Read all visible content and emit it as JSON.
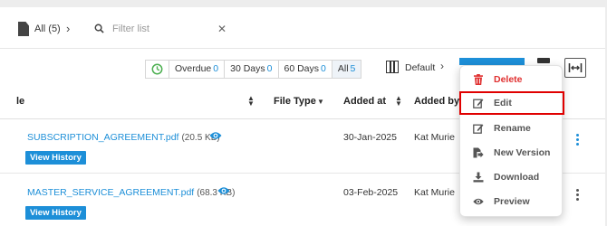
{
  "filter_bar": {
    "all_label": "All (5)",
    "search_placeholder": "Filter list",
    "clear_glyph": "✕"
  },
  "due_filter": {
    "items": [
      {
        "label": "Overdue",
        "count": "0"
      },
      {
        "label": "30 Days",
        "count": "0"
      },
      {
        "label": "60 Days",
        "count": "0"
      },
      {
        "label": "All",
        "count": "5"
      }
    ]
  },
  "view": {
    "default_label": "Default"
  },
  "table": {
    "headers": {
      "name": "le",
      "file_type": "File Type",
      "added_at": "Added at",
      "added_by": "Added by"
    },
    "rows": [
      {
        "file_name": "SUBSCRIPTION_AGREEMENT.pdf",
        "file_size": "(20.5 KB)",
        "history_label": "View History",
        "added_at": "30-Jan-2025",
        "added_by": "Kat Murie"
      },
      {
        "file_name": "MASTER_SERVICE_AGREEMENT.pdf",
        "file_size": "(68.3 KB)",
        "history_label": "View History",
        "added_at": "03-Feb-2025",
        "added_by": "Kat Murie"
      }
    ]
  },
  "menu": {
    "items": [
      {
        "label": "Delete",
        "icon": "trash-icon"
      },
      {
        "label": "Edit",
        "icon": "edit-icon"
      },
      {
        "label": "Rename",
        "icon": "rename-icon"
      },
      {
        "label": "New Version",
        "icon": "new-version-icon"
      },
      {
        "label": "Download",
        "icon": "download-icon"
      },
      {
        "label": "Preview",
        "icon": "eye-icon"
      }
    ]
  },
  "colors": {
    "accent": "#1d8fd8",
    "danger": "#e03131",
    "highlight_border": "#e00000",
    "clock_green": "#4caf50"
  }
}
